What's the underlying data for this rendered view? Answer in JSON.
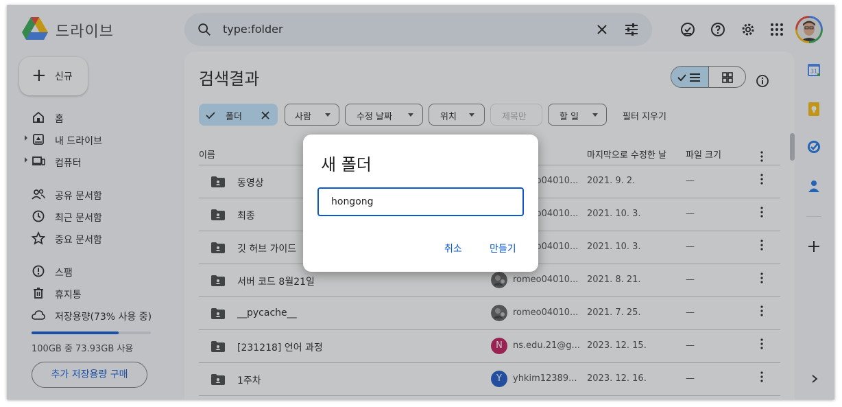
{
  "app": {
    "name": "드라이브"
  },
  "search": {
    "query": "type:folder"
  },
  "nav": {
    "new_label": "신규",
    "items": [
      {
        "label": "홈",
        "icon": "home-icon"
      },
      {
        "label": "내 드라이브",
        "icon": "my-drive-icon",
        "expandable": true
      },
      {
        "label": "컴퓨터",
        "icon": "computer-icon",
        "expandable": true
      },
      {
        "label": "공유 문서함",
        "icon": "shared-icon"
      },
      {
        "label": "최근 문서함",
        "icon": "clock-icon"
      },
      {
        "label": "중요 문서함",
        "icon": "star-icon"
      },
      {
        "label": "스팸",
        "icon": "spam-icon"
      },
      {
        "label": "휴지통",
        "icon": "trash-icon"
      },
      {
        "label": "저장용량(73% 사용 중)",
        "icon": "cloud-icon"
      }
    ],
    "storage": {
      "percent_used": 73,
      "text": "100GB 중 73.93GB 사용",
      "buy_label": "추가 저장용량 구매"
    }
  },
  "main": {
    "title": "검색결과",
    "chips": [
      {
        "label": "폴더",
        "state": "active"
      },
      {
        "label": "사람",
        "state": "dropdown"
      },
      {
        "label": "수정 날짜",
        "state": "dropdown"
      },
      {
        "label": "위치",
        "state": "dropdown"
      },
      {
        "label": "제목만",
        "state": "disabled"
      },
      {
        "label": "할 일",
        "state": "dropdown"
      }
    ],
    "clear_filters": "필터 지우기",
    "columns": {
      "name": "이름",
      "modified": "마지막으로 수정한 날",
      "size": "파일 크기"
    },
    "rows": [
      {
        "name": "동영상",
        "owner": "romeo04010...",
        "owner_avatar": "photo",
        "modified": "2021. 9. 2.",
        "size": "—"
      },
      {
        "name": "최종",
        "owner": "romeo04010...",
        "owner_avatar": "photo",
        "modified": "2021. 10. 3.",
        "size": "—"
      },
      {
        "name": "깃 허브 가이드",
        "owner": "romeo04010...",
        "owner_avatar": "photo",
        "modified": "2021. 10. 3.",
        "size": "—"
      },
      {
        "name": "서버 코드 8월21일",
        "owner": "romeo04010...",
        "owner_avatar": "photo",
        "modified": "2021. 8. 21.",
        "size": "—"
      },
      {
        "name": "__pycache__",
        "owner": "romeo04010...",
        "owner_avatar": "photo",
        "modified": "2021. 7. 25.",
        "size": "—"
      },
      {
        "name": "[231218] 언어 과정",
        "owner": "ns.edu.21@g...",
        "owner_avatar": "N",
        "owner_color": "#c2185b",
        "modified": "2023. 12. 15.",
        "size": "—"
      },
      {
        "name": "1주차",
        "owner": "yhkim12389...",
        "owner_avatar": "Y",
        "owner_color": "#1a56c7",
        "modified": "2023. 12. 16.",
        "size": "—"
      }
    ]
  },
  "dialog": {
    "title": "새 폴더",
    "input_value": "hongong",
    "cancel_label": "취소",
    "create_label": "만들기"
  },
  "colors": {
    "accent": "#0b57d0",
    "chip_active": "#c2e7ff",
    "search_bg": "#e9eef6"
  }
}
